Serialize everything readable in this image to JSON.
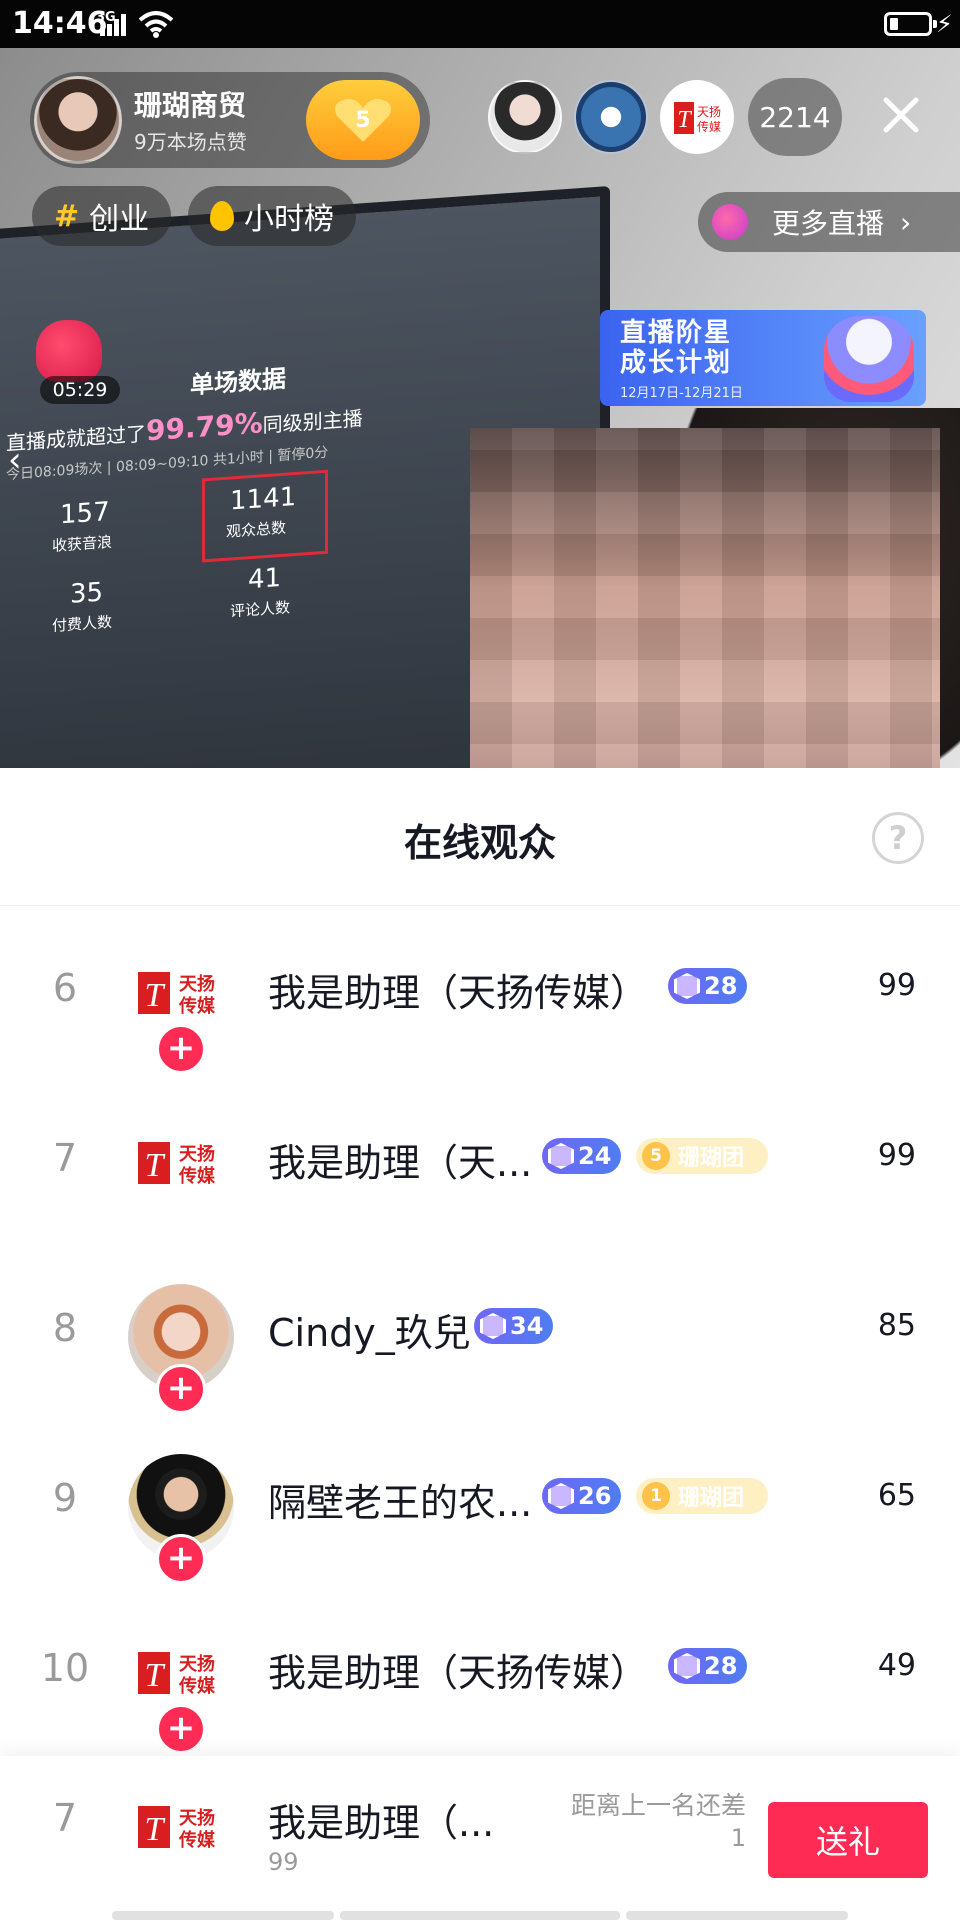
{
  "status_bar": {
    "time": "14:46",
    "network": "3G",
    "colors": {
      "background": "#050505",
      "text": "#ffffff"
    }
  },
  "live": {
    "host": {
      "name": "珊瑚商贸",
      "likes": "9万本场点赞",
      "follow_level": "5"
    },
    "viewer_count": "2214",
    "tags": [
      {
        "label": "创业",
        "icon": "hash-icon"
      },
      {
        "label": "小时榜",
        "icon": "flame-icon"
      }
    ],
    "more_live_label": "更多直播",
    "gift_timer": "05:29",
    "banner": {
      "title_line1": "直播阶星",
      "title_line2": "成长计划",
      "dates": "12月17日-12月21日"
    },
    "screen": {
      "heading": "单场数据",
      "headline_prefix": "直播成就超过了",
      "headline_percent": "99.79%",
      "headline_suffix": "同级别主播",
      "subline": "今日08:09场次 | 08:09~09:10 共1小时 | 暂停0分",
      "stats": [
        {
          "value": "157",
          "label": "收获音浪"
        },
        {
          "value": "1141",
          "label": "观众总数"
        },
        {
          "value": "35",
          "label": "付费人数"
        },
        {
          "value": "41",
          "label": "评论人数"
        }
      ]
    }
  },
  "sheet": {
    "title": "在线观众",
    "rows": [
      {
        "rank": "6",
        "name": "我是助理（天扬传媒）",
        "level": "28",
        "score": "99",
        "avatar": "tianyang-logo"
      },
      {
        "rank": "7",
        "name": "我是助理（天...",
        "level": "24",
        "fan_level": "5",
        "fan_club": "珊瑚团",
        "score": "99",
        "avatar": "tianyang-logo"
      },
      {
        "rank": "8",
        "name": "Cindy_玖兒",
        "level": "34",
        "score": "85",
        "avatar": "photo-woman"
      },
      {
        "rank": "9",
        "name": "隔壁老王的农...",
        "level": "26",
        "fan_level": "1",
        "fan_club": "珊瑚团",
        "score": "65",
        "avatar": "photo-man"
      },
      {
        "rank": "10",
        "name": "我是助理（天扬传媒）",
        "level": "28",
        "score": "49",
        "avatar": "tianyang-logo"
      }
    ],
    "footer": {
      "rank": "7",
      "name": "我是助理（...",
      "score": "99",
      "gap_label": "距离上一名还差",
      "gap_value": "1",
      "send_label": "送礼"
    },
    "logo_text": {
      "line1": "天扬",
      "line2": "传媒"
    },
    "colors": {
      "accent": "#fe2c55",
      "level_badge": "#5b72f3",
      "fan_badge": "#fff0c4",
      "text": "#161823",
      "muted": "#9a9a9a"
    }
  }
}
